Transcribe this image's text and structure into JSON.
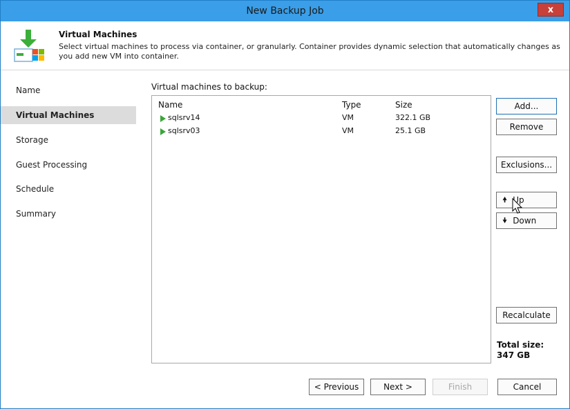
{
  "window": {
    "title": "New Backup Job",
    "close_label": "x"
  },
  "header": {
    "title": "Virtual Machines",
    "description": "Select virtual machines to process via container, or granularly. Container provides dynamic selection that automatically changes as you add new VM into container."
  },
  "nav": {
    "items": [
      {
        "label": "Name"
      },
      {
        "label": "Virtual Machines",
        "active": true
      },
      {
        "label": "Storage"
      },
      {
        "label": "Guest Processing"
      },
      {
        "label": "Schedule"
      },
      {
        "label": "Summary"
      }
    ]
  },
  "list": {
    "label": "Virtual machines to backup:",
    "columns": {
      "name": "Name",
      "type": "Type",
      "size": "Size"
    },
    "rows": [
      {
        "name": "sqlsrv14",
        "type": "VM",
        "size": "322.1 GB"
      },
      {
        "name": "sqlsrv03",
        "type": "VM",
        "size": "25.1 GB"
      }
    ]
  },
  "buttons": {
    "add": "Add...",
    "remove": "Remove",
    "exclusions": "Exclusions...",
    "up": "Up",
    "up_icon": "arrow-up-icon",
    "down": "Down",
    "down_icon": "arrow-down-icon",
    "recalculate": "Recalculate",
    "previous": "< Previous",
    "next": "Next >",
    "finish": "Finish",
    "cancel": "Cancel"
  },
  "total": {
    "label": "Total size:",
    "value": "347 GB"
  },
  "colors": {
    "titlebar": "#3a9ee8",
    "close": "#c7403a",
    "nav_active": "#dcdcdc",
    "vm_icon": "#3aa63a"
  }
}
